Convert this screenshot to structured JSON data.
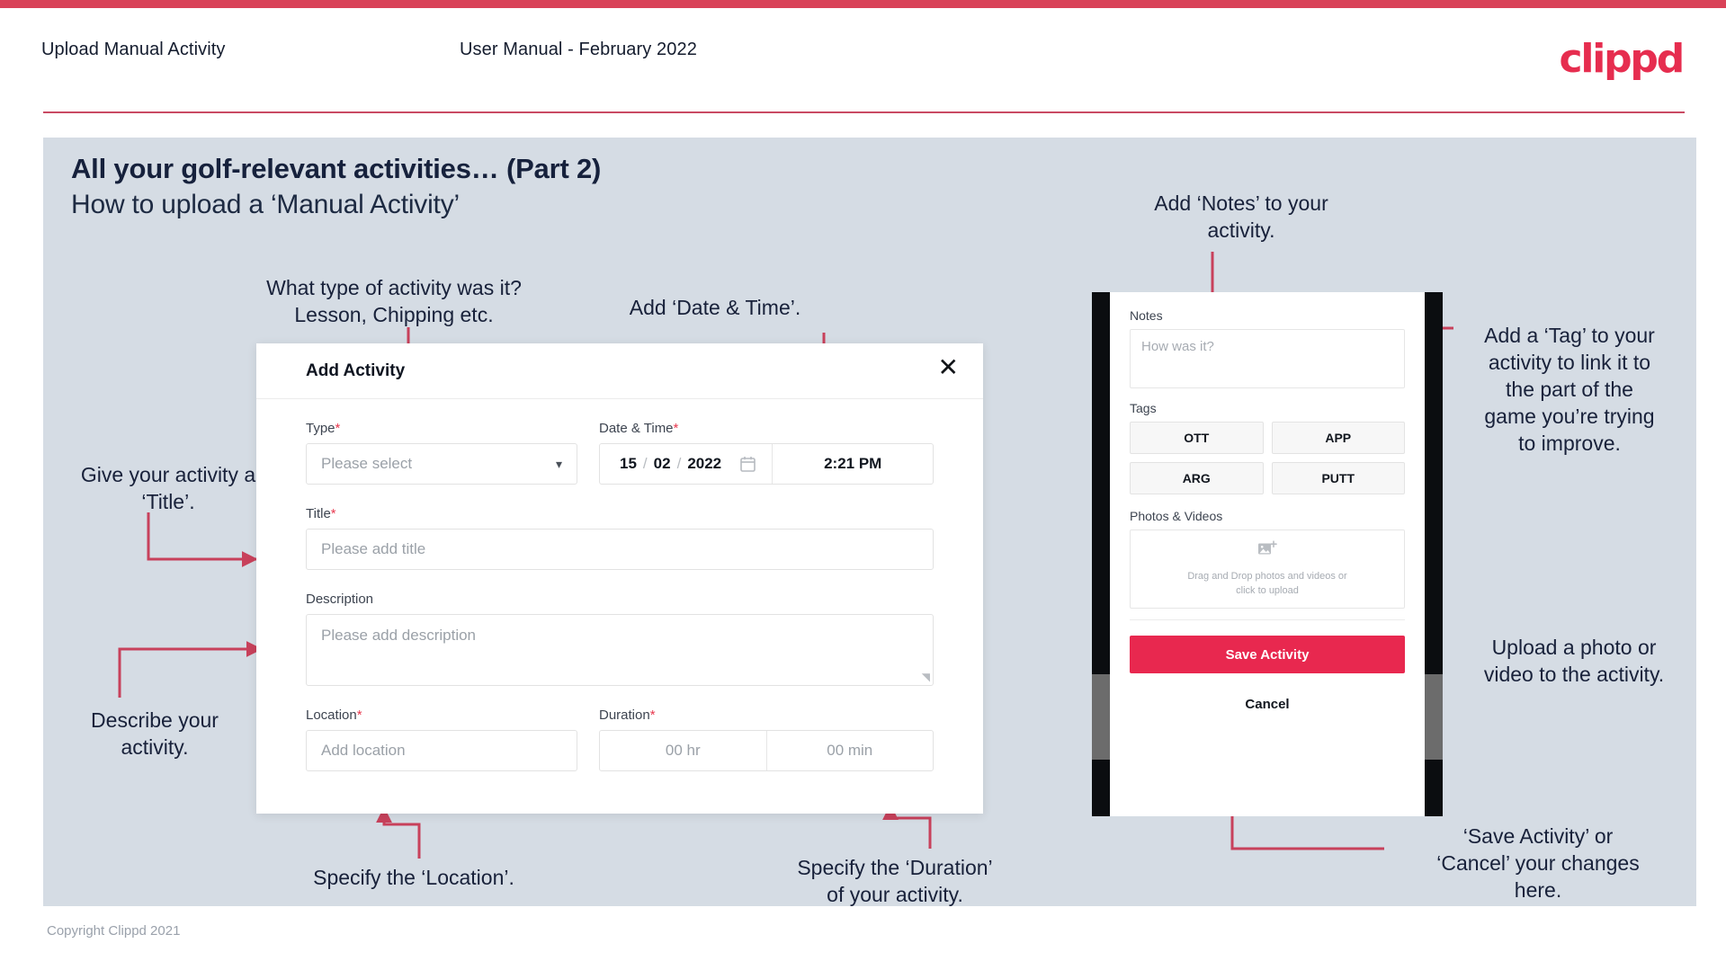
{
  "header": {
    "left_title": "Upload Manual Activity",
    "center_title": "User Manual - February 2022",
    "logo": "clippd"
  },
  "slide": {
    "title": "All your golf-relevant activities… (Part 2)",
    "subtitle": "How to upload a ‘Manual Activity’"
  },
  "footer": {
    "copyright": "Copyright Clippd 2021"
  },
  "colors": {
    "brand_pink": "#e8284f",
    "bar_crimson": "#d94258",
    "annotation_line": "#c8415b",
    "slide_bg": "#d5dce4",
    "heading_navy": "#16213c"
  },
  "dialog": {
    "title": "Add Activity",
    "close_icon": "close-icon",
    "fields": {
      "type": {
        "label": "Type",
        "required": "*",
        "placeholder": "Please select",
        "chevron": "chevron-down-icon"
      },
      "datetime": {
        "label": "Date & Time",
        "required": "*",
        "day": "15",
        "month": "02",
        "year": "2022",
        "separator": "/",
        "calendar_icon": "calendar-icon",
        "time": "2:21 PM"
      },
      "title": {
        "label": "Title",
        "required": "*",
        "placeholder": "Please add title"
      },
      "description": {
        "label": "Description",
        "required": "",
        "placeholder": "Please add description",
        "resize_grip": "resize-grip-icon"
      },
      "location": {
        "label": "Location",
        "required": "*",
        "placeholder": "Add location"
      },
      "duration": {
        "label": "Duration",
        "required": "*",
        "hours_placeholder": "00 hr",
        "minutes_placeholder": "00 min"
      }
    }
  },
  "phone": {
    "notes": {
      "label": "Notes",
      "placeholder": "How was it?"
    },
    "tags": {
      "label": "Tags",
      "items": [
        "OTT",
        "APP",
        "ARG",
        "PUTT"
      ]
    },
    "photos": {
      "label": "Photos & Videos",
      "icon": "add-image-icon",
      "line1": "Drag and Drop photos and videos or",
      "line2": "click to upload"
    },
    "save_label": "Save Activity",
    "cancel_label": "Cancel"
  },
  "annotations": {
    "type": "What type of activity was it?\nLesson, Chipping etc.",
    "datetime": "Add ‘Date & Time’.",
    "title": "Give your activity a\n‘Title’.",
    "description": "Describe your\nactivity.",
    "location": "Specify the ‘Location’.",
    "duration": "Specify the ‘Duration’\nof your activity.",
    "notes": "Add ‘Notes’ to your\nactivity.",
    "tags": "Add a ‘Tag’ to your\nactivity to link it to\nthe part of the\ngame you’re trying\nto improve.",
    "upload": "Upload a photo or\nvideo to the activity.",
    "save_cancel": "‘Save Activity’ or\n‘Cancel’ your changes\nhere."
  }
}
